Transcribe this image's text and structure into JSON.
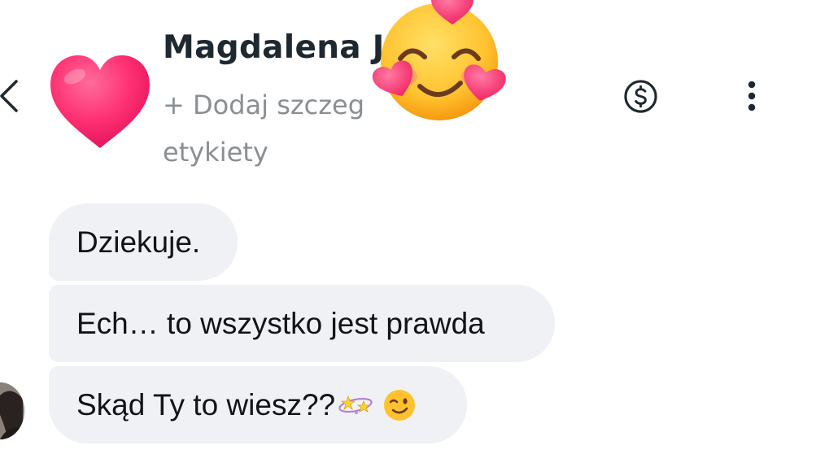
{
  "header": {
    "contact_name": "Magdalena J            wska",
    "add_details": "+ Dodaj szczeg",
    "tags_label": "etykiety",
    "back_icon": "chevron-left-icon",
    "payment_icon": "dollar-circle-icon",
    "menu_icon": "more-vertical-icon"
  },
  "stickers": {
    "left": "heart-sticker",
    "right": "smiling-face-with-hearts-sticker"
  },
  "messages": [
    {
      "text": "Dziekuje."
    },
    {
      "text": "Ech… to wszystko jest prawda"
    },
    {
      "text": "Skąd Ty to wiesz??",
      "emojis": [
        "stars-emoji",
        "winking-face-emoji"
      ]
    }
  ],
  "colors": {
    "bubble": "#eff1f4",
    "name": "#1d2830",
    "subtitle": "#8a8f93",
    "heart": "#ff2d6f",
    "emoji_face": "#ffb02e"
  }
}
